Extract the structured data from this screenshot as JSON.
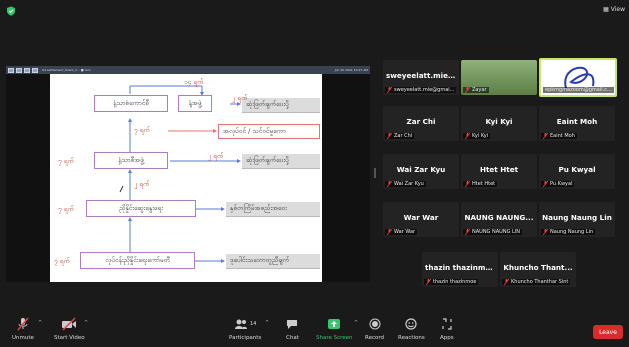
{
  "view_label": "View",
  "share": {
    "window_title": "U2 settlement_talent_d... ■ rem",
    "right_status": "Jun 20 2021 10:27 AM"
  },
  "slide": {
    "boxes": [
      "နံ့သာစံကောင်စီ",
      "နံ့အဖွဲ့",
      "နံ့သာစီအဖွဲ့",
      "ညှိနှိုင်းဆွေးနွေးရေး",
      "လုပ်ငန်းညှိနှိုင်းရေးကော်မတီ"
    ],
    "gray_boxes": [
      "ဆုံးဖြတ်ချက်ပေးပို့",
      "ဆုံးဖြတ်ချက်ပေးပို့",
      "နှစ်တကြိမ်အစည်းအဝေး",
      "ဒုပေါင်းသဘောတူညီချက်"
    ],
    "red_box": "အလုပ်ဝင် / သင်ဝင်မှုကော",
    "labels": [
      "၁၄ ရက်",
      "၂ ရက်",
      "၇ ရက်",
      "၇ ရက်",
      "၂ ရက်",
      "၂ ရက်",
      "၇ ရက်",
      "၇ ရက်"
    ]
  },
  "participants": [
    {
      "name": "sweyeelatt.mie...",
      "label": "sweyeelatt.mie@gmai..."
    },
    {
      "name": "",
      "label": "Zayar"
    },
    {
      "name": "",
      "label": "epkmgmazoom@gmail.c..."
    },
    {
      "name": "Zar Chi",
      "label": "Zar Chi"
    },
    {
      "name": "Kyi Kyi",
      "label": "Kyi Kyi"
    },
    {
      "name": "Eaint Moh",
      "label": "Eaint Moh"
    },
    {
      "name": "Wai Zar Kyu",
      "label": "Wai Zar Kyu"
    },
    {
      "name": "Htet Htet",
      "label": "Htet Htet"
    },
    {
      "name": "Pu Kwyal",
      "label": "Pu Kwyal"
    },
    {
      "name": "War War",
      "label": "War War"
    },
    {
      "name": "NAUNG NAUNG...",
      "label": "NAUNG NAUNG LIN"
    },
    {
      "name": "Naung Naung Lin",
      "label": "Naung Naung Lin"
    },
    {
      "name": "thazin thazinmoe",
      "label": "thazin thazinmoe"
    },
    {
      "name": "Khuncho Thant...",
      "label": "Khuncho Thanthar Sint"
    }
  ],
  "toolbar": {
    "unmute": "Unmute",
    "start_video": "Start Video",
    "participants": "Participants",
    "participants_count": "14",
    "chat": "Chat",
    "share_screen": "Share Screen",
    "record": "Record",
    "reactions": "Reactions",
    "apps": "Apps",
    "leave": "Leave"
  },
  "colors": {
    "share_green": "#35c66b",
    "leave_red": "#d92d2d",
    "highlight": "#c6e66a"
  }
}
